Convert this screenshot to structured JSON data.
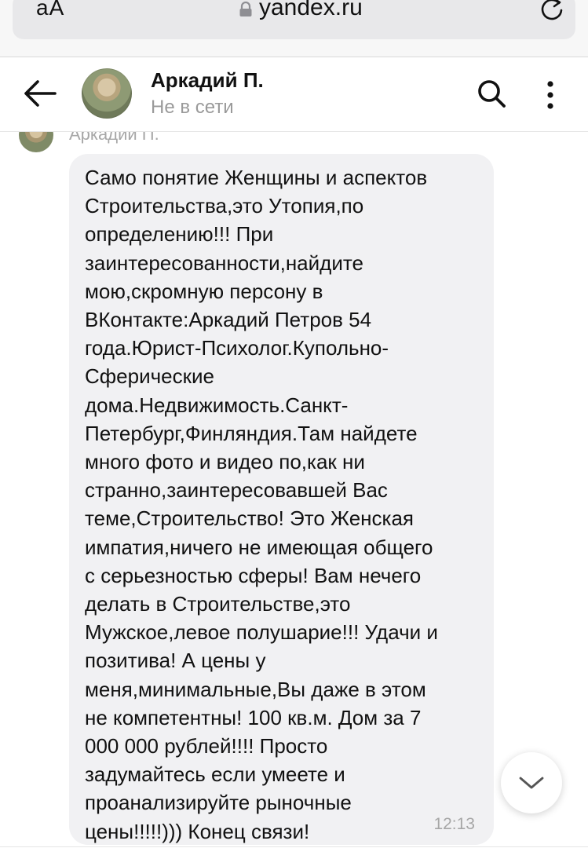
{
  "browser": {
    "text_size_label": "aA",
    "url": "yandex.ru"
  },
  "header": {
    "contact_name": "Аркадий П.",
    "status": "Не в сети"
  },
  "message": {
    "sender_name": "Аркадий П.",
    "text": "Само понятие Женщины и аспектов\nСтроительства,это Утопия,по\nопределению!!! При\nзаинтересованности,найдите\nмою,скромную персону в\nВКонтакте:Аркадий Петров 54\nгода.Юрист-Психолог.Купольно-\nСферические\nдома.Недвижимость.Санкт-\nПетербург,Финляндия.Там найдете\nмного фото и видео по,как ни\nстранно,заинтересовавшей Вас\nтеме,Строительство! Это Женская\nимпатия,ничего не имеющая общего\nс серьезностью сферы! Вам нечего\nделать в Строительстве,это\nМужское,левое полушарие!!! Удачи и\nпозитива! А цены у\nменя,минимальные,Вы даже в этом\nне компетентны! 100 кв.м. Дом за 7\n000 000 рублей!!!! Просто\nзадумайтесь если умеете и\nпроанализируйте рыночные\nцены!!!!!))) Конец связи!",
    "time": "12:13"
  },
  "icons": {
    "lock": "lock-icon",
    "reload": "reload-icon",
    "back": "back-arrow-icon",
    "search": "search-icon",
    "more": "more-vertical-icon",
    "scroll_down": "chevron-down-icon"
  },
  "colors": {
    "url_bar_background": "#e8e8ea",
    "bubble_background": "#f1f1f3",
    "muted_text": "#9a9a9a"
  }
}
